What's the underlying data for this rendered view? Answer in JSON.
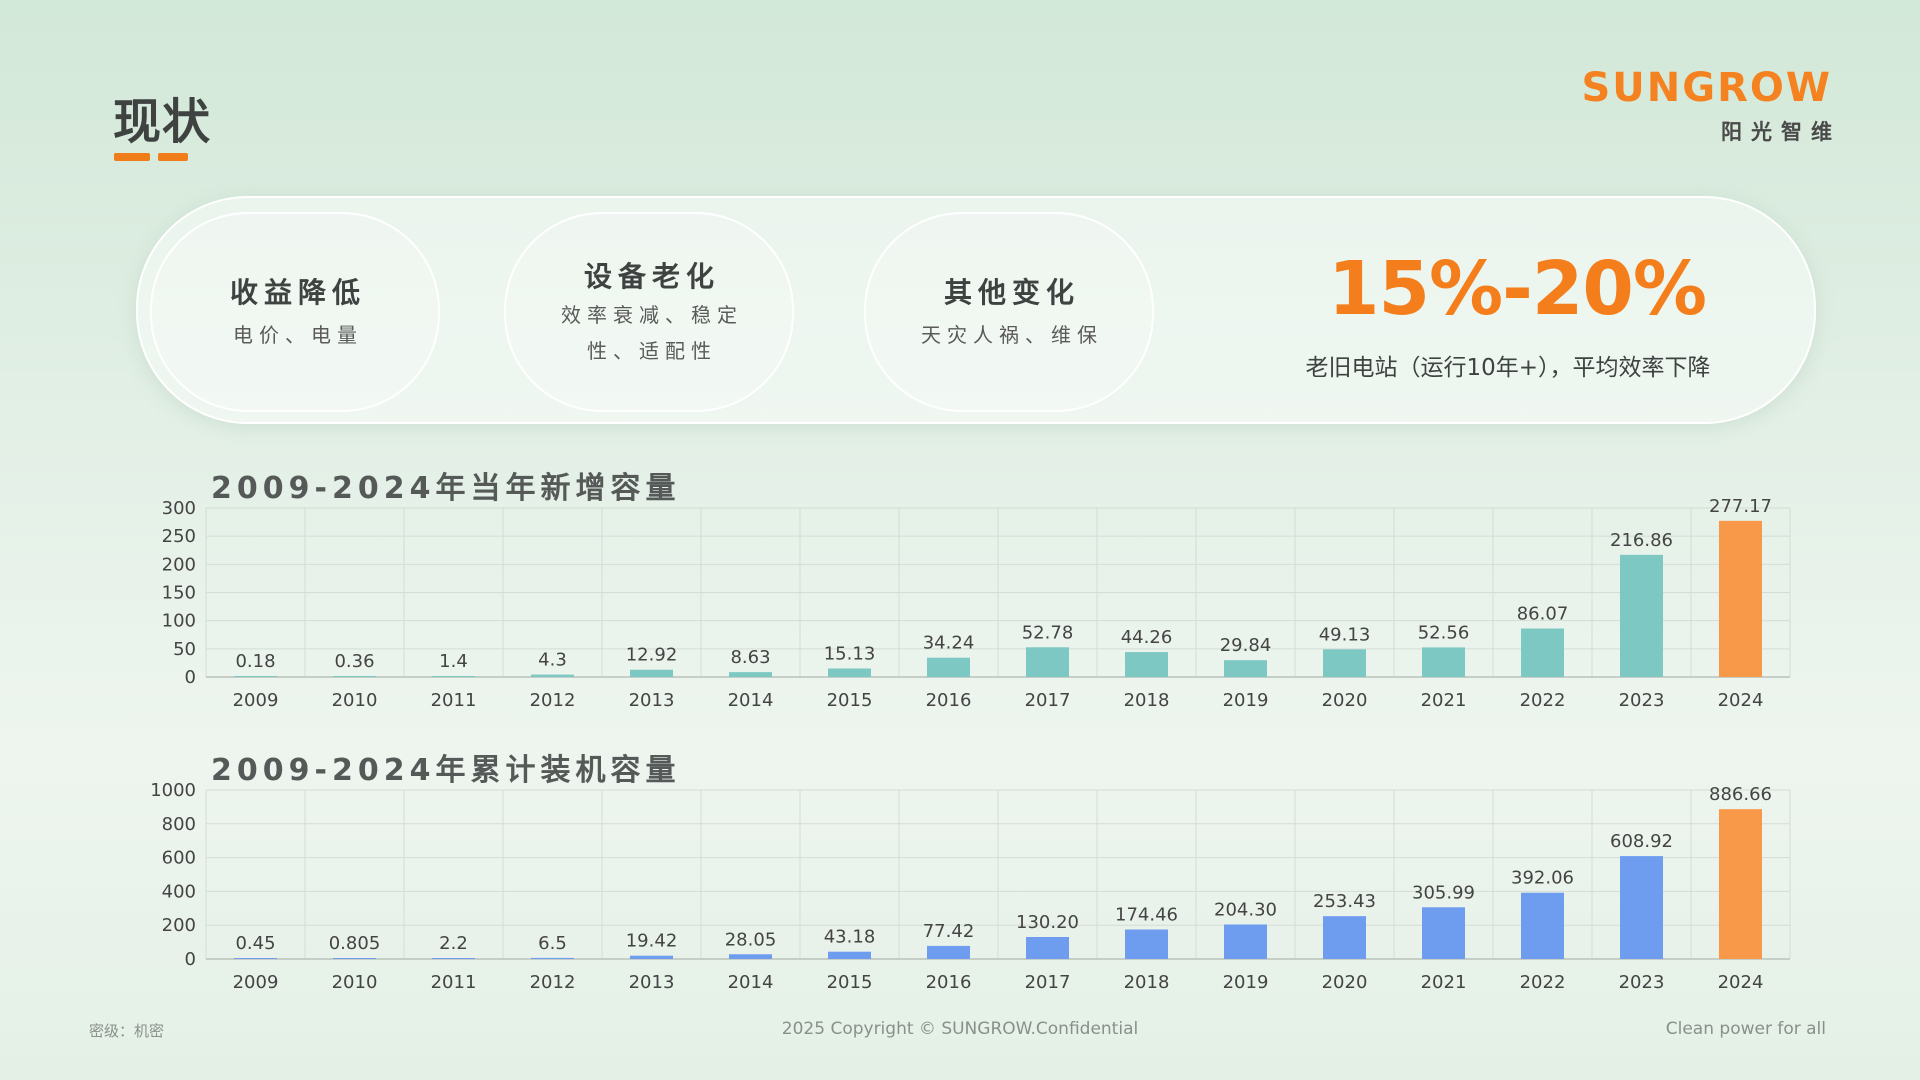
{
  "header": {
    "title": "现状",
    "logo_text": "SUNGROW",
    "logo_subtext": "阳光智维"
  },
  "colors": {
    "accent": "#f57e1c",
    "teal_bar": "#7ec8c4",
    "blue_bar": "#6e9cef",
    "highlight_bar": "#f8994a"
  },
  "summary": {
    "pills": [
      {
        "title": "收益降低",
        "sub": "电价、电量"
      },
      {
        "title": "设备老化",
        "sub": "效率衰减、稳定性、适配性"
      },
      {
        "title": "其他变化",
        "sub": "天灾人祸、维保"
      }
    ],
    "stat_value": "15%-20%",
    "stat_caption": "老旧电站（运行10年+），平均效率下降"
  },
  "chart_data": [
    {
      "type": "bar",
      "title": "2009-2024年当年新增容量",
      "categories": [
        "2009",
        "2010",
        "2011",
        "2012",
        "2013",
        "2014",
        "2015",
        "2016",
        "2017",
        "2018",
        "2019",
        "2020",
        "2021",
        "2022",
        "2023",
        "2024"
      ],
      "values": [
        0.18,
        0.36,
        1.4,
        4.3,
        12.92,
        8.63,
        15.13,
        34.24,
        52.78,
        44.26,
        29.84,
        49.13,
        52.56,
        86.07,
        216.86,
        277.17
      ],
      "labels": [
        "0.18",
        "0.36",
        "1.4",
        "4.3",
        "12.92",
        "8.63",
        "15.13",
        "34.24",
        "52.78",
        "44.26",
        "29.84",
        "49.13",
        "52.56",
        "86.07",
        "216.86",
        "277.17"
      ],
      "yticks": [
        "0",
        "50",
        "100",
        "150",
        "200",
        "250",
        "300"
      ],
      "ylim": [
        0,
        300
      ],
      "grid": true,
      "bar_color": "#7ec8c4",
      "highlight_index": 15,
      "highlight_color": "#f8994a"
    },
    {
      "type": "bar",
      "title": "2009-2024年累计装机容量",
      "categories": [
        "2009",
        "2010",
        "2011",
        "2012",
        "2013",
        "2014",
        "2015",
        "2016",
        "2017",
        "2018",
        "2019",
        "2020",
        "2021",
        "2022",
        "2023",
        "2024"
      ],
      "values": [
        0.45,
        0.805,
        2.2,
        6.5,
        19.42,
        28.05,
        43.18,
        77.42,
        130.2,
        174.46,
        204.3,
        253.43,
        305.99,
        392.06,
        608.92,
        886.66
      ],
      "labels": [
        "0.45",
        "0.805",
        "2.2",
        "6.5",
        "19.42",
        "28.05",
        "43.18",
        "77.42",
        "130.20",
        "174.46",
        "204.30",
        "253.43",
        "305.99",
        "392.06",
        "608.92",
        "886.66"
      ],
      "yticks": [
        "0",
        "200",
        "400",
        "600",
        "800",
        "1000"
      ],
      "ylim": [
        0,
        1000
      ],
      "grid": true,
      "bar_color": "#6e9cef",
      "highlight_index": 15,
      "highlight_color": "#f8994a"
    }
  ],
  "footer": {
    "classification": "密级：机密",
    "copyright": "2025 Copyright © SUNGROW.Confidential",
    "tagline": "Clean power for all"
  }
}
